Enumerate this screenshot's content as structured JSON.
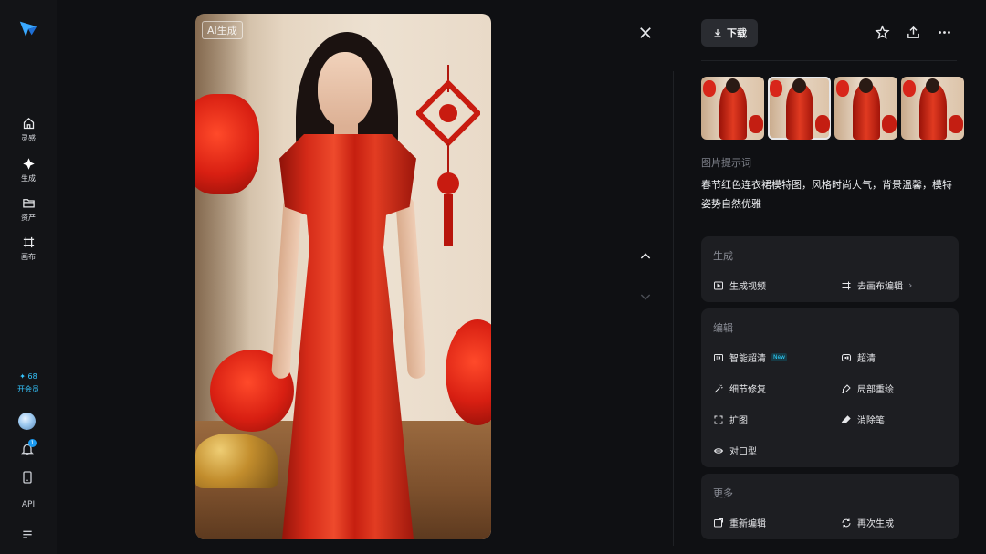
{
  "photo": {
    "ai_tag": "AI生成"
  },
  "sidebar": {
    "items": [
      {
        "label": "灵感",
        "icon": "home-icon"
      },
      {
        "label": "生成",
        "icon": "sparkle-icon"
      },
      {
        "label": "资产",
        "icon": "folder-icon"
      },
      {
        "label": "画布",
        "icon": "canvas-icon"
      }
    ],
    "credits": "✦ 68",
    "membership": "开会员",
    "notification_count": "1",
    "api_label": "API"
  },
  "toolbar": {
    "download_label": "下载"
  },
  "thumbnails": {
    "count": 4,
    "active_index": 1
  },
  "prompt": {
    "title": "图片提示词",
    "text": "春节红色连衣裙模特图，风格时尚大气，背景温馨，模特姿势自然优雅"
  },
  "sections": {
    "generate": {
      "title": "生成",
      "actions": [
        "生成视频",
        "去画布编辑"
      ]
    },
    "edit": {
      "title": "编辑",
      "actions": [
        "智能超清",
        "超清",
        "细节修复",
        "局部重绘",
        "扩图",
        "消除笔",
        "对口型"
      ],
      "new_tag": "New"
    },
    "more": {
      "title": "更多",
      "actions": [
        "重新编辑",
        "再次生成"
      ]
    }
  },
  "colors": {
    "accent": "#35c6ff",
    "background": "#0f1013",
    "card": "#1d1e22"
  }
}
